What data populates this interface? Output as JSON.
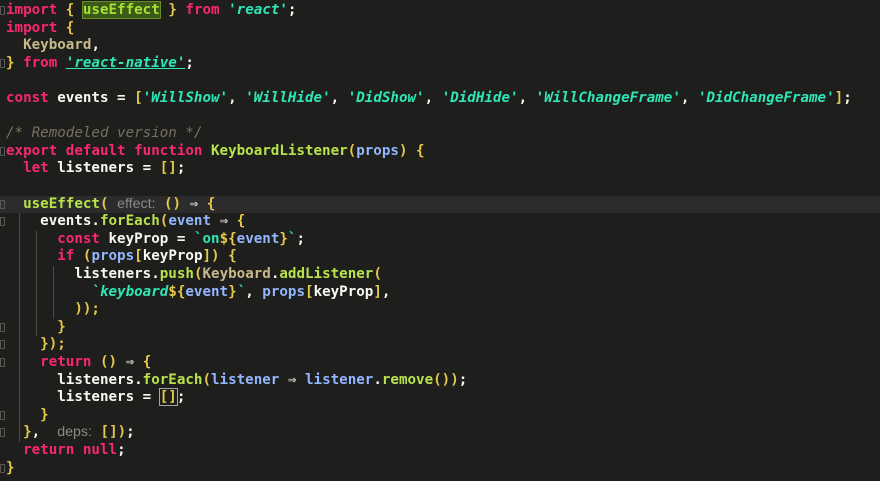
{
  "editor": {
    "lines": [
      {
        "tokens": [
          [
            "kw",
            "import"
          ],
          [
            "op",
            " "
          ],
          [
            "brace",
            "{"
          ],
          [
            "op",
            " "
          ],
          [
            "ident hl",
            "useEffect"
          ],
          [
            "op",
            " "
          ],
          [
            "brace",
            "}"
          ],
          [
            "kw",
            " from "
          ],
          [
            "str",
            "'react'"
          ],
          [
            "txt",
            ";"
          ]
        ]
      },
      {
        "tokens": [
          [
            "kw",
            "import"
          ],
          [
            "op",
            " "
          ],
          [
            "brace",
            "{"
          ]
        ]
      },
      {
        "tokens": [
          [
            "op",
            "  "
          ],
          [
            "obj",
            "Keyboard"
          ],
          [
            "txt",
            ","
          ]
        ]
      },
      {
        "tokens": [
          [
            "brace",
            "}"
          ],
          [
            "kw",
            " from "
          ],
          [
            "str ul",
            "'react-native'"
          ],
          [
            "txt",
            ";"
          ]
        ]
      },
      {
        "tokens": []
      },
      {
        "tokens": [
          [
            "kw",
            "const"
          ],
          [
            "txt",
            " events = "
          ],
          [
            "brace",
            "["
          ],
          [
            "str",
            "'WillShow'"
          ],
          [
            "txt",
            ", "
          ],
          [
            "str",
            "'WillHide'"
          ],
          [
            "txt",
            ", "
          ],
          [
            "str",
            "'DidShow'"
          ],
          [
            "txt",
            ", "
          ],
          [
            "str",
            "'DidHide'"
          ],
          [
            "txt",
            ", "
          ],
          [
            "str",
            "'WillChangeFrame'"
          ],
          [
            "txt",
            ", "
          ],
          [
            "str",
            "'DidChangeFrame'"
          ],
          [
            "brace",
            "]"
          ],
          [
            "txt",
            ";"
          ]
        ]
      },
      {
        "tokens": []
      },
      {
        "tokens": [
          [
            "comment",
            "/* Remodeled version */"
          ]
        ]
      },
      {
        "tokens": [
          [
            "kw",
            "export default function "
          ],
          [
            "fn",
            "KeyboardListener"
          ],
          [
            "paren",
            "("
          ],
          [
            "param",
            "props"
          ],
          [
            "paren",
            ")"
          ],
          [
            "txt",
            " "
          ],
          [
            "brace",
            "{"
          ]
        ]
      },
      {
        "tokens": [
          [
            "op",
            "  "
          ],
          [
            "kw",
            "let"
          ],
          [
            "txt",
            " listeners = "
          ],
          [
            "brace",
            "[]"
          ],
          [
            "txt",
            ";"
          ]
        ]
      },
      {
        "tokens": []
      },
      {
        "tokens": [
          [
            "op",
            "  "
          ],
          [
            "fn",
            "useEffect"
          ],
          [
            "paren",
            "("
          ],
          [
            "op",
            " "
          ],
          [
            "hint",
            "effect:"
          ],
          [
            "op",
            " "
          ],
          [
            "paren",
            "()"
          ],
          [
            "op",
            " ⇒ "
          ],
          [
            "brace",
            "{"
          ]
        ]
      },
      {
        "tokens": [
          [
            "op",
            "    "
          ],
          [
            "txt",
            "events."
          ],
          [
            "fn",
            "forEach"
          ],
          [
            "paren",
            "("
          ],
          [
            "param",
            "event"
          ],
          [
            "op",
            " ⇒ "
          ],
          [
            "brace",
            "{"
          ]
        ]
      },
      {
        "tokens": [
          [
            "op",
            "      "
          ],
          [
            "kw",
            "const"
          ],
          [
            "txt",
            " keyProp = "
          ],
          [
            "tmpl",
            "`on"
          ],
          [
            "brace",
            "${"
          ],
          [
            "param",
            "event"
          ],
          [
            "brace",
            "}"
          ],
          [
            "tmpl",
            "`"
          ],
          [
            "txt",
            ";"
          ]
        ]
      },
      {
        "tokens": [
          [
            "op",
            "      "
          ],
          [
            "kw",
            "if"
          ],
          [
            "txt",
            " "
          ],
          [
            "paren",
            "("
          ],
          [
            "param",
            "props"
          ],
          [
            "brace",
            "["
          ],
          [
            "txt",
            "keyProp"
          ],
          [
            "brace",
            "]"
          ],
          [
            "paren",
            ")"
          ],
          [
            "txt",
            " "
          ],
          [
            "brace",
            "{"
          ]
        ]
      },
      {
        "tokens": [
          [
            "op",
            "        "
          ],
          [
            "txt",
            "listeners."
          ],
          [
            "fn",
            "push"
          ],
          [
            "paren",
            "("
          ],
          [
            "obj",
            "Keyboard"
          ],
          [
            "txt",
            "."
          ],
          [
            "fn",
            "addListener"
          ],
          [
            "paren",
            "("
          ]
        ]
      },
      {
        "tokens": [
          [
            "op",
            "          "
          ],
          [
            "str",
            "`keyboard"
          ],
          [
            "brace",
            "${"
          ],
          [
            "param",
            "event"
          ],
          [
            "brace",
            "}"
          ],
          [
            "str",
            "`"
          ],
          [
            "txt",
            ", "
          ],
          [
            "param",
            "props"
          ],
          [
            "brace",
            "["
          ],
          [
            "txt",
            "keyProp"
          ],
          [
            "brace",
            "]"
          ],
          [
            "txt",
            ","
          ]
        ]
      },
      {
        "tokens": [
          [
            "op",
            "        "
          ],
          [
            "paren",
            "));"
          ]
        ]
      },
      {
        "tokens": [
          [
            "op",
            "      "
          ],
          [
            "brace",
            "}"
          ]
        ]
      },
      {
        "tokens": [
          [
            "op",
            "    "
          ],
          [
            "brace",
            "}"
          ],
          [
            "paren",
            ");"
          ]
        ]
      },
      {
        "tokens": [
          [
            "op",
            "    "
          ],
          [
            "kw",
            "return"
          ],
          [
            "txt",
            " "
          ],
          [
            "paren",
            "()"
          ],
          [
            "op",
            " ⇒ "
          ],
          [
            "brace",
            "{"
          ]
        ]
      },
      {
        "tokens": [
          [
            "op",
            "      "
          ],
          [
            "txt",
            "listeners."
          ],
          [
            "fn",
            "forEach"
          ],
          [
            "paren",
            "("
          ],
          [
            "param",
            "listener"
          ],
          [
            "op",
            " ⇒ "
          ],
          [
            "param",
            "listener"
          ],
          [
            "txt",
            "."
          ],
          [
            "fn",
            "remove"
          ],
          [
            "paren",
            "())"
          ],
          [
            "txt",
            ";"
          ]
        ]
      },
      {
        "tokens": [
          [
            "op",
            "      "
          ],
          [
            "txt",
            "listeners = "
          ],
          [
            "brace hl2",
            "[]"
          ],
          [
            "txt",
            ";"
          ]
        ]
      },
      {
        "tokens": [
          [
            "op",
            "    "
          ],
          [
            "brace",
            "}"
          ]
        ]
      },
      {
        "tokens": [
          [
            "op",
            "  "
          ],
          [
            "brace",
            "}"
          ],
          [
            "txt",
            ",  "
          ],
          [
            "hint",
            "deps:"
          ],
          [
            "op",
            " "
          ],
          [
            "brace",
            "[]"
          ],
          [
            "paren",
            ")"
          ],
          [
            "txt",
            ";"
          ]
        ]
      },
      {
        "tokens": [
          [
            "op",
            "  "
          ],
          [
            "kw",
            "return null"
          ],
          [
            "txt",
            ";"
          ]
        ]
      },
      {
        "tokens": [
          [
            "brace",
            "}"
          ]
        ]
      }
    ],
    "current_line": 11,
    "fold_lines": [
      0,
      3,
      8,
      11,
      12,
      18,
      19,
      20,
      23,
      24,
      26
    ]
  }
}
